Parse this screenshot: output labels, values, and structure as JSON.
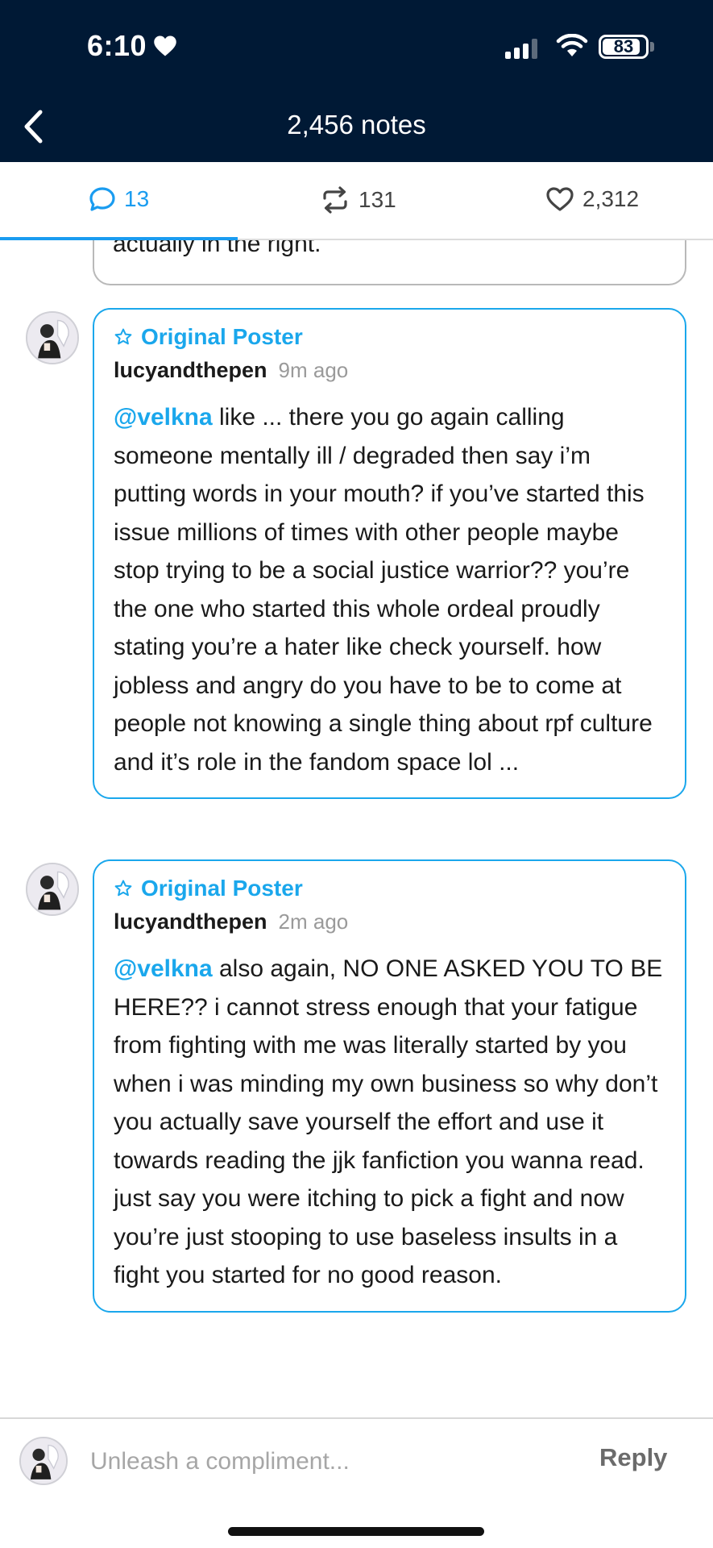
{
  "status_bar": {
    "time": "6:10",
    "battery_percent": "83"
  },
  "header": {
    "title": "2,456 notes"
  },
  "tabs": [
    {
      "label": "13",
      "icon": "comment-icon",
      "active": true
    },
    {
      "label": "131",
      "icon": "reblog-icon",
      "active": false
    },
    {
      "label": "2,312",
      "icon": "heart-icon",
      "active": false
    }
  ],
  "previous_comment": {
    "tail_text": "actually in the right."
  },
  "comments": [
    {
      "badge": "Original Poster",
      "username": "lucyandthepen",
      "time_ago": "9m ago",
      "mention": "@velkna",
      "text": " like ... there you go again calling someone mentally ill / degraded then say i’m putting words in your mouth? if you’ve started this issue millions of times with other people maybe stop trying to be a social justice warrior?? you’re the one who started this whole ordeal proudly stating you’re a hater like check yourself. how jobless and angry do you have to be to come at people not knowing a single thing about rpf culture and it’s role in the fandom space lol ..."
    },
    {
      "badge": "Original Poster",
      "username": "lucyandthepen",
      "time_ago": "2m ago",
      "mention": "@velkna",
      "text": " also again, NO ONE ASKED YOU TO BE HERE?? i cannot stress enough that your fatigue from fighting with me was literally started by you when i was minding my own business so why don’t you actually save yourself the effort and use it towards reading the jjk fanfiction you wanna read. just say you were itching to pick a fight and now you’re just stooping to use baseless insults in a fight you started for no good reason."
    }
  ],
  "reply_bar": {
    "placeholder": "Unleash a compliment...",
    "reply_label": "Reply"
  },
  "colors": {
    "header_bg": "#001935",
    "accent": "#1aa7ec"
  }
}
